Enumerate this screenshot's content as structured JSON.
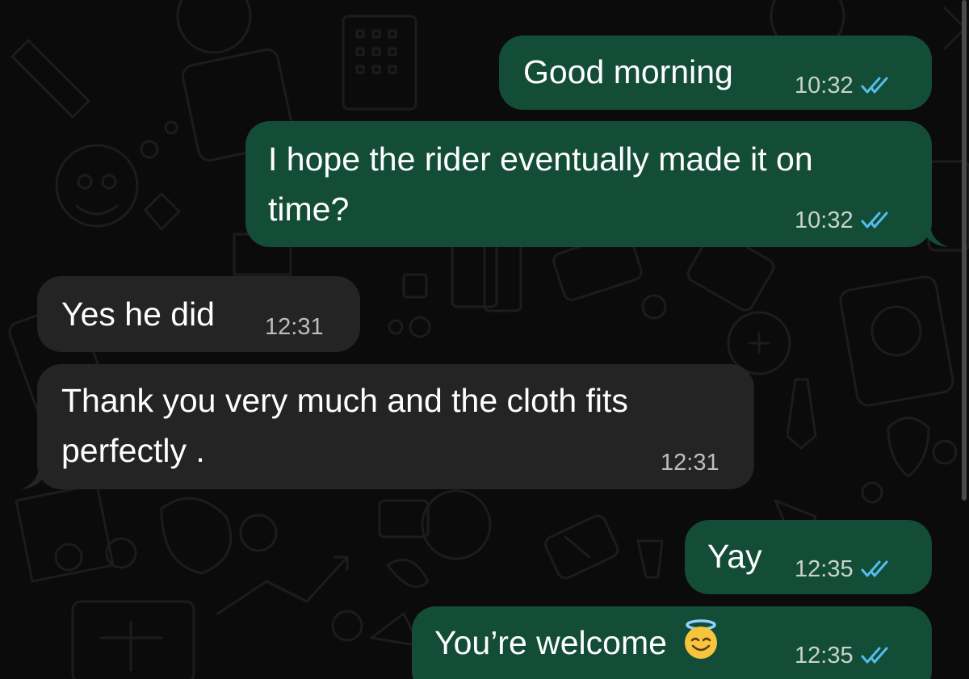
{
  "colors": {
    "background": "#0b0b0b",
    "outgoing_bubble": "#134d37",
    "incoming_bubble": "#242424",
    "read_ticks": "#53bdeb",
    "timestamp": "#c9d3ce"
  },
  "messages": [
    {
      "direction": "outgoing",
      "lines": [
        "Good morning"
      ],
      "time": "10:32",
      "status": "read-double-check-icon"
    },
    {
      "direction": "outgoing",
      "lines": [
        "I hope the rider eventually made it on",
        "time?"
      ],
      "time": "10:32",
      "status": "read-double-check-icon"
    },
    {
      "direction": "incoming",
      "lines": [
        "Yes he did"
      ],
      "time": "12:31"
    },
    {
      "direction": "incoming",
      "lines": [
        "Thank you very much and the cloth fits",
        "perfectly ."
      ],
      "time": "12:31"
    },
    {
      "direction": "outgoing",
      "lines": [
        "Yay"
      ],
      "time": "12:35",
      "status": "read-double-check-icon"
    },
    {
      "direction": "outgoing",
      "lines": [
        "You’re welcome"
      ],
      "time": "12:35",
      "status": "read-double-check-icon",
      "emoji": "smiling-face-with-halo-emoji"
    }
  ]
}
